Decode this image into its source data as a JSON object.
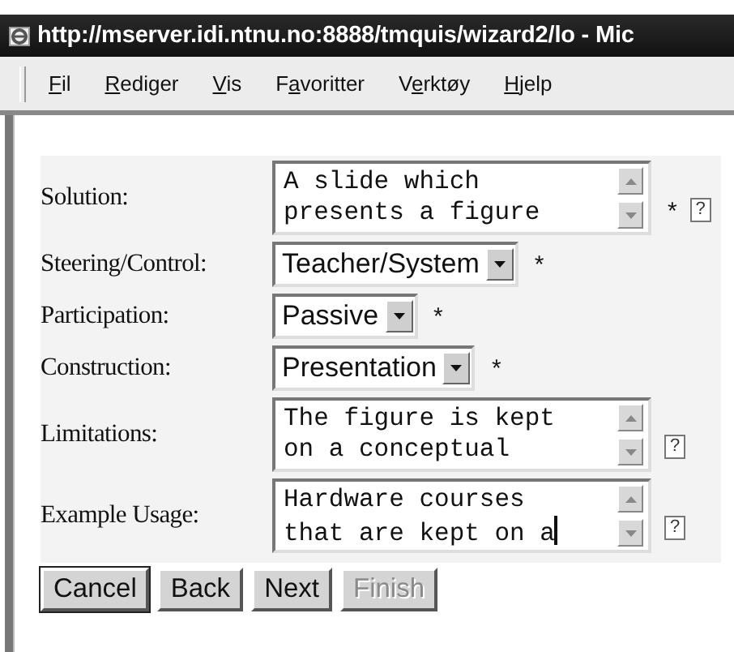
{
  "window": {
    "title": "http://mserver.idi.ntnu.no:8888/tmquis/wizard2/lo - Mic"
  },
  "menu": [
    {
      "key": "F",
      "rest": "il"
    },
    {
      "key": "R",
      "rest": "ediger"
    },
    {
      "key": "V",
      "rest": "is"
    },
    {
      "prefix": "F",
      "key": "a",
      "rest": "voritter"
    },
    {
      "prefix": "V",
      "key": "e",
      "rest": "rktøy"
    },
    {
      "key": "H",
      "rest": "jelp"
    }
  ],
  "form": {
    "rows": [
      {
        "label": "Solution:",
        "kind": "textarea",
        "lines": [
          "A slide which",
          "presents a figure"
        ],
        "required": "*",
        "help": "?",
        "focused": false
      },
      {
        "label": "Steering/Control:",
        "kind": "select",
        "value": "Teacher/System",
        "required": "*"
      },
      {
        "label": "Participation:",
        "kind": "select",
        "value": "Passive",
        "required": "*"
      },
      {
        "label": "Construction:",
        "kind": "select",
        "value": "Presentation",
        "required": "*"
      },
      {
        "label": "Limitations:",
        "kind": "textarea",
        "lines": [
          "The figure is kept",
          "on a conceptual"
        ],
        "help": "?",
        "focused": false
      },
      {
        "label": "Example Usage:",
        "kind": "textarea",
        "lines": [
          "Hardware courses",
          "that are kept on a"
        ],
        "help": "?",
        "focused": true
      }
    ]
  },
  "buttons": [
    {
      "label": "Cancel",
      "disabled": false
    },
    {
      "label": "Back",
      "disabled": false
    },
    {
      "label": "Next",
      "disabled": false
    },
    {
      "label": "Finish",
      "disabled": true
    }
  ]
}
